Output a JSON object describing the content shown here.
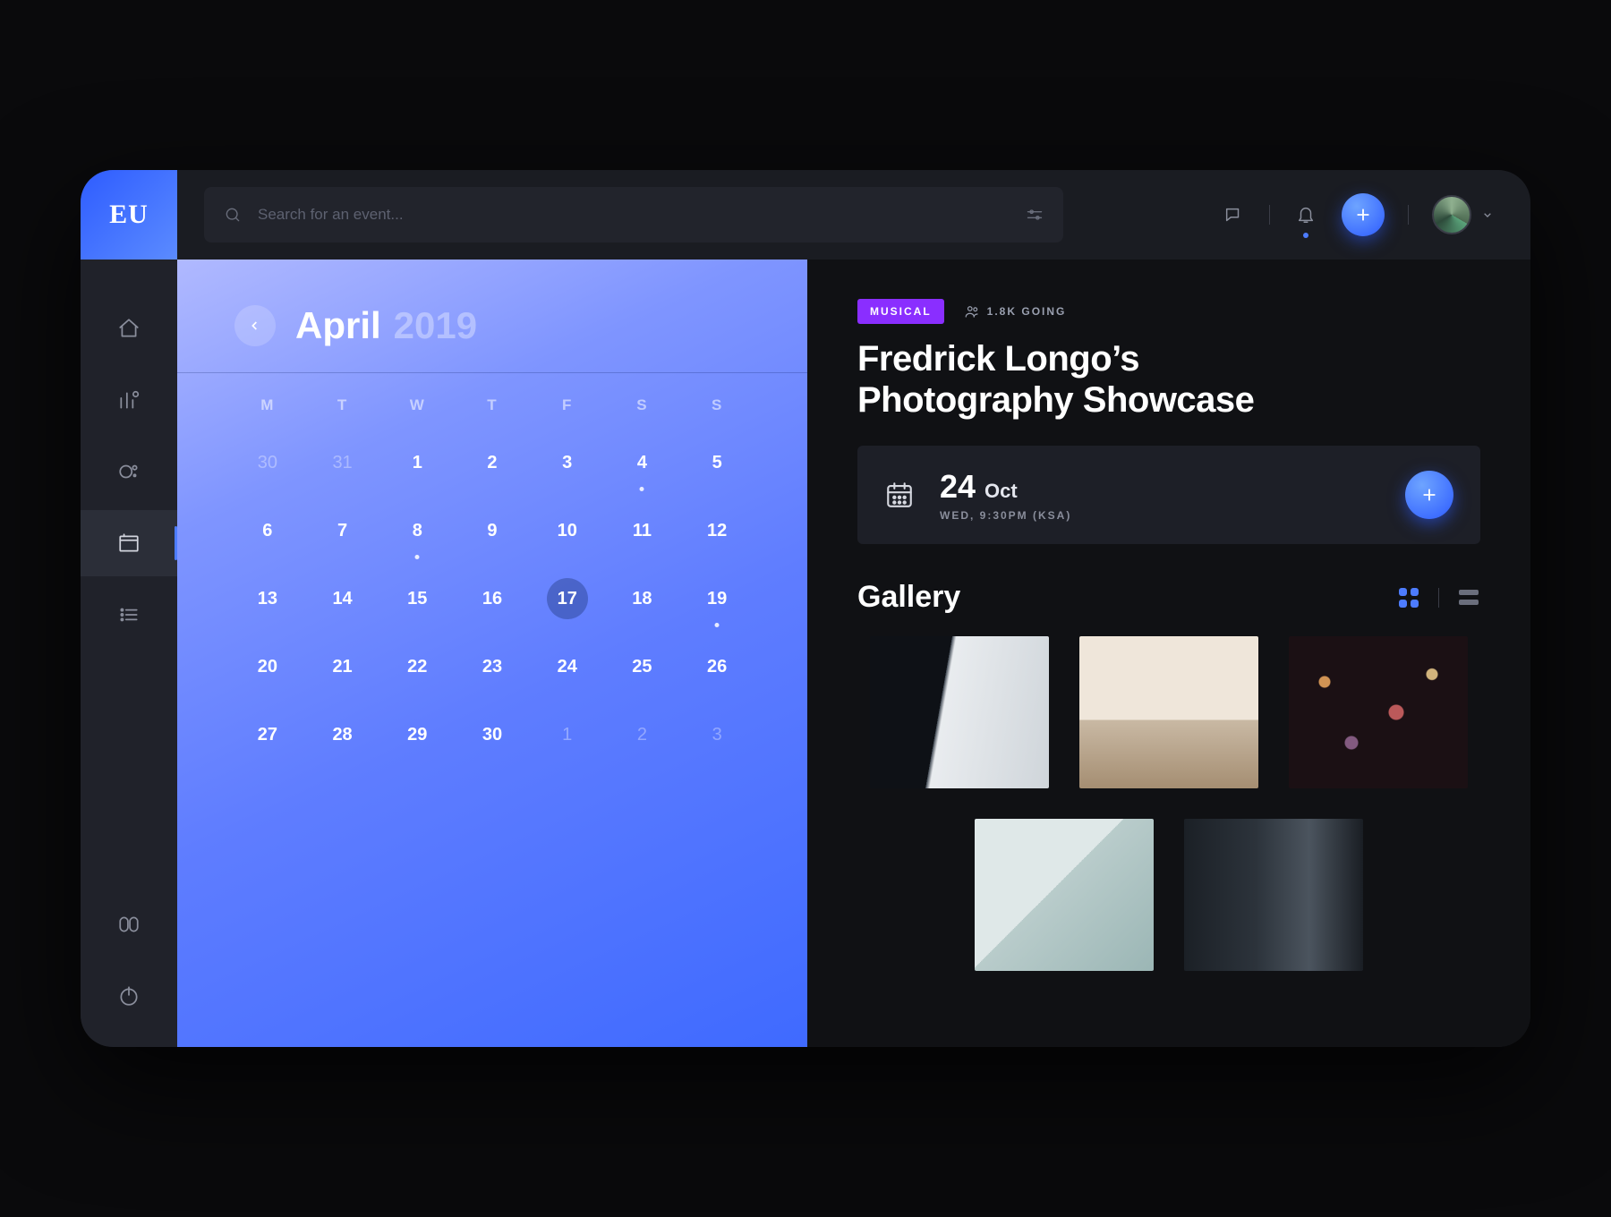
{
  "brand": {
    "logo_text": "EU"
  },
  "search": {
    "placeholder": "Search for an event..."
  },
  "sidebar": {
    "items": [
      {
        "name": "home"
      },
      {
        "name": "analytics"
      },
      {
        "name": "discover"
      },
      {
        "name": "calendar",
        "active": true
      },
      {
        "name": "list"
      }
    ],
    "bottom": [
      {
        "name": "apps"
      },
      {
        "name": "power"
      }
    ]
  },
  "calendar": {
    "month": "April",
    "year": "2019",
    "dow": [
      "M",
      "T",
      "W",
      "T",
      "F",
      "S",
      "S"
    ],
    "weeks": [
      [
        {
          "n": "30",
          "dim": true
        },
        {
          "n": "31",
          "dim": true
        },
        {
          "n": "1"
        },
        {
          "n": "2"
        },
        {
          "n": "3"
        },
        {
          "n": "4",
          "dot": true
        },
        {
          "n": "5"
        }
      ],
      [
        {
          "n": "6"
        },
        {
          "n": "7"
        },
        {
          "n": "8",
          "dot": true
        },
        {
          "n": "9"
        },
        {
          "n": "10"
        },
        {
          "n": "11"
        },
        {
          "n": "12"
        }
      ],
      [
        {
          "n": "13"
        },
        {
          "n": "14"
        },
        {
          "n": "15"
        },
        {
          "n": "16"
        },
        {
          "n": "17",
          "selected": true
        },
        {
          "n": "18"
        },
        {
          "n": "19",
          "dot": true
        }
      ],
      [
        {
          "n": "20"
        },
        {
          "n": "21"
        },
        {
          "n": "22"
        },
        {
          "n": "23"
        },
        {
          "n": "24"
        },
        {
          "n": "25"
        },
        {
          "n": "26"
        }
      ],
      [
        {
          "n": "27"
        },
        {
          "n": "28"
        },
        {
          "n": "29"
        },
        {
          "n": "30"
        },
        {
          "n": "1",
          "dim": true
        },
        {
          "n": "2",
          "dim": true
        },
        {
          "n": "3",
          "dim": true
        }
      ]
    ]
  },
  "event": {
    "tag": "MUSICAL",
    "going": "1.8K GOING",
    "title_line1": "Fredrick Longo’s",
    "title_line2": "Photography Showcase",
    "date_num": "24",
    "date_month": "Oct",
    "date_sub": "WED, 9:30PM (KSA)",
    "gallery_title": "Gallery"
  },
  "colors": {
    "accent": "#4d7cff",
    "tag": "#8a2eff"
  }
}
